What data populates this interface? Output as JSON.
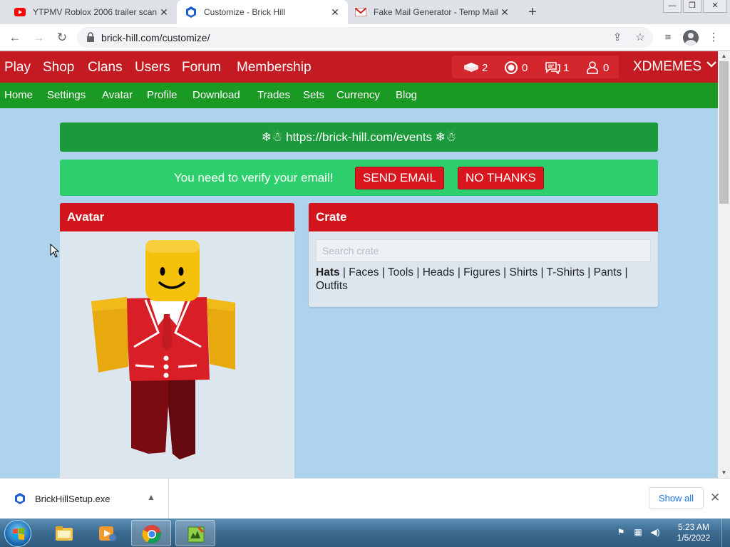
{
  "browser": {
    "tabs": [
      {
        "title": "YTPMV Roblox 2006 trailer scan",
        "favicon": "youtube-icon",
        "active": false
      },
      {
        "title": "Customize - Brick Hill",
        "favicon": "brick-hill-icon",
        "active": true
      },
      {
        "title": "Fake Mail Generator - Temp Mail",
        "favicon": "gmail-icon",
        "active": false
      }
    ],
    "url": "brick-hill.com/customize/"
  },
  "site": {
    "colors": {
      "nav": "#c41a21",
      "subnav": "#1a9a23",
      "background": "#aed3ec"
    },
    "nav": [
      "Play",
      "Shop",
      "Clans",
      "Users",
      "Forum",
      "Membership"
    ],
    "stats": {
      "bricks": "2",
      "bits": "0",
      "messages": "1",
      "friend_requests": "0"
    },
    "username": "XDMEMES",
    "subnav": [
      "Home",
      "Settings",
      "Avatar",
      "Profile",
      "Download",
      "Trades",
      "Sets",
      "Currency",
      "Blog"
    ],
    "events_banner": "❄☃ https://brick-hill.com/events ❄☃",
    "verify": {
      "message": "You need to verify your email!",
      "send_label": "SEND EMAIL",
      "dismiss_label": "NO THANKS"
    },
    "avatar_card": {
      "title": "Avatar"
    },
    "crate_card": {
      "title": "Crate",
      "search_placeholder": "Search crate",
      "categories": [
        "Hats",
        "Faces",
        "Tools",
        "Heads",
        "Figures",
        "Shirts",
        "T-Shirts",
        "Pants",
        "Outfits"
      ]
    }
  },
  "downloads": {
    "file": "BrickHillSetup.exe",
    "show_all": "Show all"
  },
  "taskbar": {
    "time": "5:23 AM",
    "date": "1/5/2022"
  }
}
